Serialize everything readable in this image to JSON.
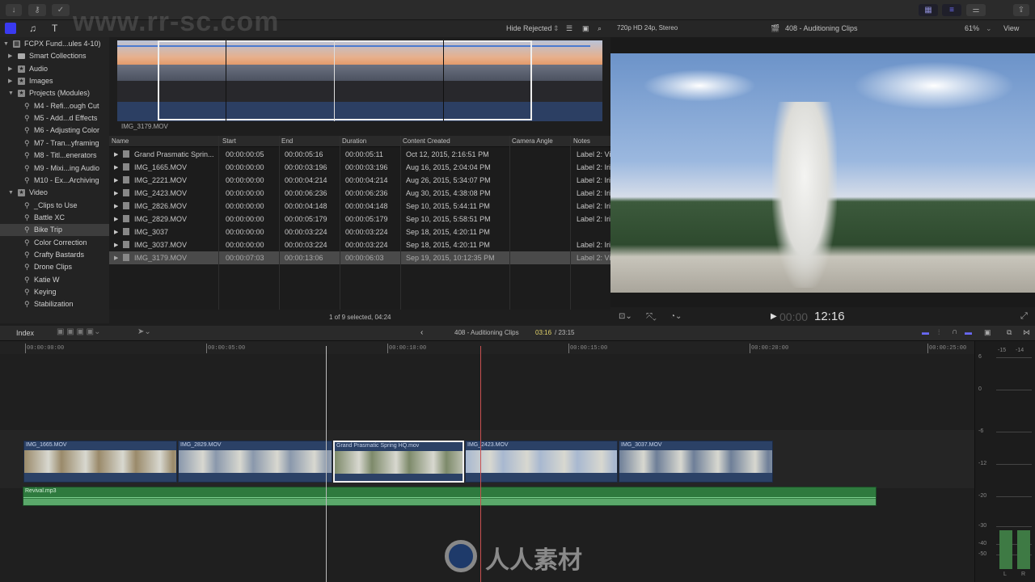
{
  "toolbar": {
    "import_icon": "download-arrow",
    "keyword_icon": "key",
    "check_icon": "checkmark-circle",
    "right_icons": [
      "browser-grid",
      "timeline-view",
      "inspector-sliders",
      "share"
    ]
  },
  "browser_bar": {
    "filter": "Hide Rejected",
    "format": "720p HD 24p, Stereo",
    "project": "408 - Auditioning Clips",
    "zoom": "61%",
    "view": "View"
  },
  "sidebar": {
    "items": [
      {
        "label": "FCPX Fund...ules 4-10)",
        "level": 0,
        "icon": "library",
        "expanded": true
      },
      {
        "label": "Smart Collections",
        "level": 1,
        "icon": "folder",
        "expanded": false
      },
      {
        "label": "Audio",
        "level": 1,
        "icon": "star-event",
        "expanded": false
      },
      {
        "label": "Images",
        "level": 1,
        "icon": "star-event",
        "expanded": false
      },
      {
        "label": "Projects (Modules)",
        "level": 1,
        "icon": "star-event",
        "expanded": true
      },
      {
        "label": "M4 - Refi...ough Cut",
        "level": 2,
        "icon": "keyword"
      },
      {
        "label": "M5 - Add...d Effects",
        "level": 2,
        "icon": "keyword"
      },
      {
        "label": "M6 - Adjusting Color",
        "level": 2,
        "icon": "keyword"
      },
      {
        "label": "M7 - Tran...yframing",
        "level": 2,
        "icon": "keyword"
      },
      {
        "label": "M8 - Titl...enerators",
        "level": 2,
        "icon": "keyword"
      },
      {
        "label": "M9 - Mixi...ing Audio",
        "level": 2,
        "icon": "keyword"
      },
      {
        "label": "M10 - Ex...Archiving",
        "level": 2,
        "icon": "keyword"
      },
      {
        "label": "Video",
        "level": 1,
        "icon": "star-event",
        "expanded": true
      },
      {
        "label": "_Clips to Use",
        "level": 2,
        "icon": "keyword"
      },
      {
        "label": "Battle XC",
        "level": 2,
        "icon": "keyword"
      },
      {
        "label": "Bike Trip",
        "level": 2,
        "icon": "keyword",
        "selected": true
      },
      {
        "label": "Color Correction",
        "level": 2,
        "icon": "keyword"
      },
      {
        "label": "Crafty Bastards",
        "level": 2,
        "icon": "keyword"
      },
      {
        "label": "Drone Clips",
        "level": 2,
        "icon": "keyword"
      },
      {
        "label": "Katie W",
        "level": 2,
        "icon": "keyword"
      },
      {
        "label": "Keying",
        "level": 2,
        "icon": "keyword"
      },
      {
        "label": "Stabilization",
        "level": 2,
        "icon": "keyword"
      }
    ]
  },
  "filmstrip": {
    "clip_name": "IMG_3179.MOV"
  },
  "list": {
    "columns": [
      "Name",
      "Start",
      "End",
      "Duration",
      "Content Created",
      "Camera Angle",
      "Notes"
    ],
    "rows": [
      [
        "Grand Prasmatic Sprin...",
        "00:00:00:05",
        "00:00:05:16",
        "00:00:05:11",
        "Oct 12, 2015, 2:16:51 PM",
        "",
        "Label 2: Vi"
      ],
      [
        "IMG_1665.MOV",
        "00:00:00:00",
        "00:00:03:196",
        "00:00:03:196",
        "Aug 16, 2015, 2:04:04 PM",
        "",
        "Label 2: Iri"
      ],
      [
        "IMG_2221.MOV",
        "00:00:00:00",
        "00:00:04:214",
        "00:00:04:214",
        "Aug 26, 2015, 5:34:07 PM",
        "",
        "Label 2: Iri"
      ],
      [
        "IMG_2423.MOV",
        "00:00:00:00",
        "00:00:06:236",
        "00:00:06:236",
        "Aug 30, 2015, 4:38:08 PM",
        "",
        "Label 2: Iri"
      ],
      [
        "IMG_2826.MOV",
        "00:00:00:00",
        "00:00:04:148",
        "00:00:04:148",
        "Sep 10, 2015, 5:44:11 PM",
        "",
        "Label 2: Iri"
      ],
      [
        "IMG_2829.MOV",
        "00:00:00:00",
        "00:00:05:179",
        "00:00:05:179",
        "Sep 10, 2015, 5:58:51 PM",
        "",
        "Label 2: Iri"
      ],
      [
        "IMG_3037",
        "00:00:00:00",
        "00:00:03:224",
        "00:00:03:224",
        "Sep 18, 2015, 4:20:11 PM",
        "",
        ""
      ],
      [
        "IMG_3037.MOV",
        "00:00:00:00",
        "00:00:03:224",
        "00:00:03:224",
        "Sep 18, 2015, 4:20:11 PM",
        "",
        "Label 2: Iri"
      ],
      [
        "IMG_3179.MOV",
        "00:00:07:03",
        "00:00:13:06",
        "00:00:06:03",
        "Sep 19, 2015, 10:12:35 PM",
        "",
        "Label 2: Vi"
      ]
    ],
    "selected_index": 8,
    "status": "1 of 9 selected, 04:24"
  },
  "viewer": {
    "timecode_dim": "00:00",
    "timecode": "12:16"
  },
  "timeline_bar": {
    "index": "Index",
    "project": "408 - Auditioning Clips",
    "position": "03:16",
    "total": "/ 23:15"
  },
  "ruler": {
    "labels": [
      "00:00:00:00",
      "00:00:05:00",
      "00:00:10:00",
      "00:00:15:00",
      "00:00:20:00",
      "00:00:25:00"
    ]
  },
  "clips": [
    {
      "name": "IMG_1665.MOV",
      "color": "#9a8a6a"
    },
    {
      "name": "IMG_2829.MOV",
      "color": "#8a98ac"
    },
    {
      "name": "Grand Prasmatic Spring HQ.mov",
      "color": "#7d8a6a",
      "selected": true
    },
    {
      "name": "IMG_2423.MOV",
      "color": "#a8b8d0"
    },
    {
      "name": "IMG_3037.MOV",
      "color": "#6e7f98"
    }
  ],
  "audio_clip": {
    "name": "Revival.mp3"
  },
  "meters": {
    "peak_left": "-15",
    "peak_right": "-14",
    "scale": [
      "6",
      "0",
      "-6",
      "-12",
      "-20",
      "-30",
      "-40",
      "-50"
    ],
    "channels": [
      "L",
      "R"
    ]
  },
  "watermark": {
    "url": "www.rr-sc.com",
    "brand": "人人素材"
  }
}
